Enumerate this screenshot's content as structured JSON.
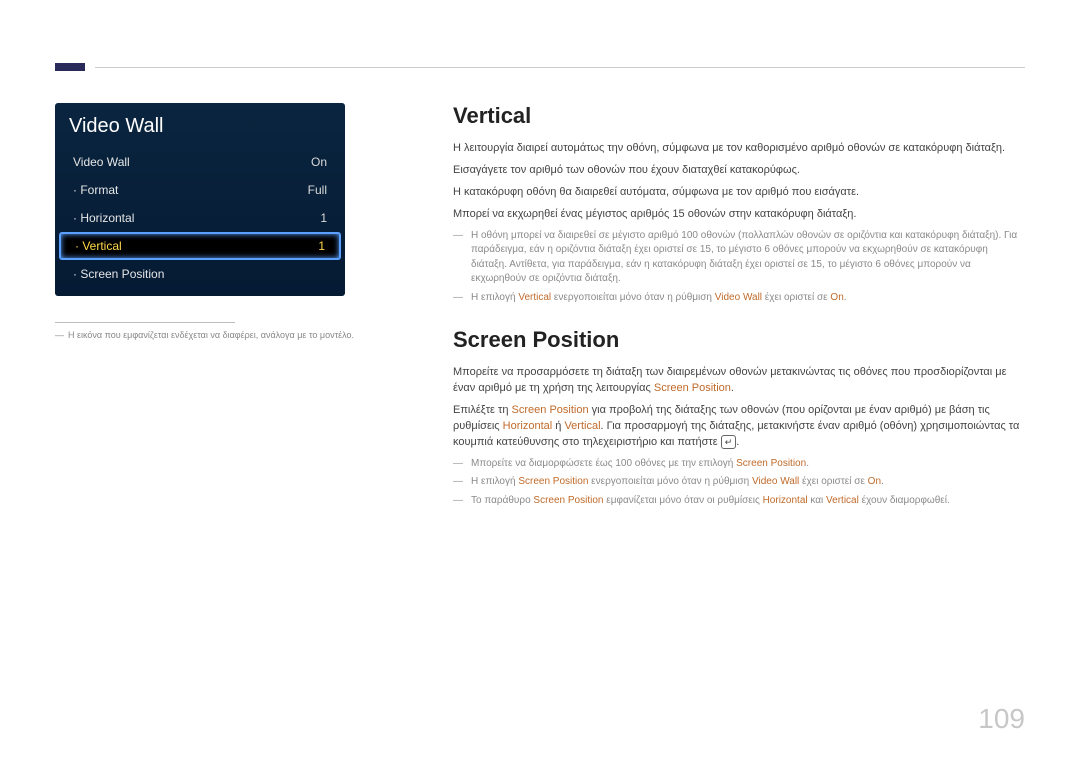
{
  "page_number": "109",
  "menu": {
    "title": "Video Wall",
    "rows": [
      {
        "label": "Video Wall",
        "value": "On",
        "sub": false,
        "selected": false
      },
      {
        "label": "· Format",
        "value": "Full",
        "sub": true,
        "selected": false
      },
      {
        "label": "· Horizontal",
        "value": "1",
        "sub": true,
        "selected": false
      },
      {
        "label": "· Vertical",
        "value": "1",
        "sub": true,
        "selected": true
      },
      {
        "label": "· Screen Position",
        "value": "",
        "sub": true,
        "selected": false
      }
    ]
  },
  "footnote": "Η εικόνα που εμφανίζεται ενδέχεται να διαφέρει, ανάλογα με το μοντέλο.",
  "section1": {
    "heading": "Vertical",
    "p1": "Η λειτουργία διαιρεί αυτομάτως την οθόνη, σύμφωνα με τον καθορισμένο αριθμό οθονών σε κατακόρυφη διάταξη.",
    "p2": "Εισαγάγετε τον αριθμό των οθονών που έχουν διαταχθεί κατακορύφως.",
    "p3": "Η κατακόρυφη οθόνη θα διαιρεθεί αυτόματα, σύμφωνα με τον αριθμό που εισάγατε.",
    "p4": "Μπορεί να εκχωρηθεί ένας μέγιστος αριθμός 15 οθονών στην κατακόρυφη διάταξη.",
    "note1": "Η οθόνη μπορεί να διαιρεθεί σε μέγιστο αριθμό 100 οθονών (πολλαπλών οθονών σε οριζόντια και κατακόρυφη διάταξη). Για παράδειγμα, εάν η οριζόντια διάταξη έχει οριστεί σε 15, το μέγιστο 6 οθόνες μπορούν να εκχωρηθούν σε κατακόρυφη διάταξη. Αντίθετα, για παράδειγμα, εάν η κατακόρυφη διάταξη έχει οριστεί σε 15, το μέγιστο 6 οθόνες μπορούν να εκχωρηθούν σε οριζόντια διάταξη.",
    "note2_a": "Η επιλογή ",
    "note2_b": "Vertical",
    "note2_c": " ενεργοποιείται μόνο όταν η ρύθμιση ",
    "note2_d": "Video Wall",
    "note2_e": " έχει οριστεί σε ",
    "note2_f": "On",
    "note2_g": "."
  },
  "section2": {
    "heading": "Screen Position",
    "p1_a": "Μπορείτε να προσαρμόσετε τη διάταξη των διαιρεμένων οθονών μετακινώντας τις οθόνες που προσδιορίζονται με έναν αριθμό με τη χρήση της λειτουργίας ",
    "p1_b": "Screen Position",
    "p1_c": ".",
    "p2_a": "Επιλέξτε τη ",
    "p2_b": "Screen Position",
    "p2_c": " για προβολή της διάταξης των οθονών (που ορίζονται με έναν αριθμό) με βάση τις ρυθμίσεις ",
    "p2_d": "Horizontal",
    "p2_e": " ή ",
    "p2_f": "Vertical",
    "p2_g": ". Για προσαρμογή της διάταξης, μετακινήστε έναν αριθμό (οθόνη) χρησιμοποιώντας τα κουμπιά κατεύθυνσης στο τηλεχειριστήριο και πατήστε ",
    "enter_glyph": "↵",
    "p2_h": ".",
    "note1_a": "Μπορείτε να διαμορφώσετε έως 100 οθόνες με την επιλογή ",
    "note1_b": "Screen Position",
    "note1_c": ".",
    "note2_a": "Η επιλογή ",
    "note2_b": "Screen Position",
    "note2_c": " ενεργοποιείται μόνο όταν η ρύθμιση ",
    "note2_d": "Video Wall",
    "note2_e": " έχει οριστεί σε ",
    "note2_f": "On",
    "note2_g": ".",
    "note3_a": "Το παράθυρο ",
    "note3_b": "Screen Position",
    "note3_c": " εμφανίζεται μόνο όταν οι ρυθμίσεις ",
    "note3_d": "Horizontal",
    "note3_e": " και ",
    "note3_f": "Vertical",
    "note3_g": " έχουν διαμορφωθεί."
  }
}
